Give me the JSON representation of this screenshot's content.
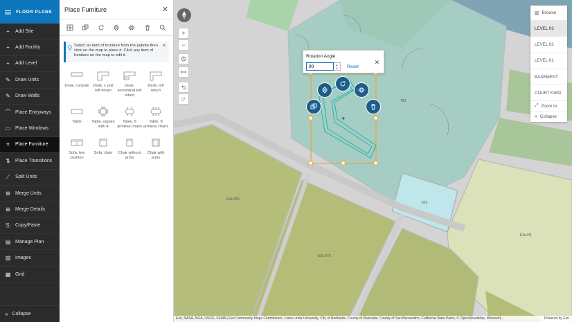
{
  "nav": {
    "title": "FLOOR PLANS",
    "items": [
      {
        "label": "Add Site"
      },
      {
        "label": "Add Facility"
      },
      {
        "label": "Add Level"
      },
      {
        "label": "Draw Units"
      },
      {
        "label": "Draw Walls"
      },
      {
        "label": "Place Entryways"
      },
      {
        "label": "Place Windows"
      },
      {
        "label": "Place Furniture"
      },
      {
        "label": "Place Transitions"
      },
      {
        "label": "Split Units"
      },
      {
        "label": "Merge Units"
      },
      {
        "label": "Merge Details"
      },
      {
        "label": "Copy/Paste"
      },
      {
        "label": "Manage Plan"
      },
      {
        "label": "Images"
      },
      {
        "label": "Grid"
      }
    ],
    "active_index": 7,
    "collapse_label": "Collapse"
  },
  "panel": {
    "title": "Place Furniture",
    "hint": "Select an item of furniture from the palette then click on the map to place it. Click any item of furniture on the map to edit it.",
    "items": [
      {
        "label": "Desk, console"
      },
      {
        "label": "Desk, L unit left return"
      },
      {
        "label": "Desk, secretarial left return"
      },
      {
        "label": "Desk, left return"
      },
      {
        "label": "Table"
      },
      {
        "label": "Table, square with 4"
      },
      {
        "label": "Table, 6 armless chairs"
      },
      {
        "label": "Table, 8 armless chairs"
      },
      {
        "label": "Sofa, two cushion"
      },
      {
        "label": "Sofa, chair"
      },
      {
        "label": "Chair without arms"
      },
      {
        "label": "Chair with arms"
      }
    ]
  },
  "rotation": {
    "title": "Rotation Angle",
    "value": "90",
    "reset_label": "Reset"
  },
  "levels": {
    "browse_label": "Browse",
    "items": [
      "LEVEL 03",
      "LEVEL 02",
      "LEVEL 01",
      "BASEMENT",
      "COURTYARD"
    ],
    "active_index": 0,
    "zoom_label": "Zoom to",
    "collapse_label": "Collapse"
  },
  "map": {
    "rooms": [
      "793",
      "423",
      "E3s-265",
      "E3s-270",
      "E3s-H1"
    ]
  },
  "attribution": {
    "text": "Esri, NASA, NGA, USGS, FEMA | Esri Community Maps Contributors, Loma Linda University, City of Redlands, County of Riverside, County of San Bernardino, California State Parks, © OpenStreetMap, Microsoft,...",
    "powered": "Powered by Esri"
  },
  "colors": {
    "brand": "#0e76bd",
    "nav_bg": "#2b2b2b",
    "selection": "#f29a2e",
    "furniture_outline": "#1fb5b0",
    "handle_fill": "#1c5d8a"
  }
}
